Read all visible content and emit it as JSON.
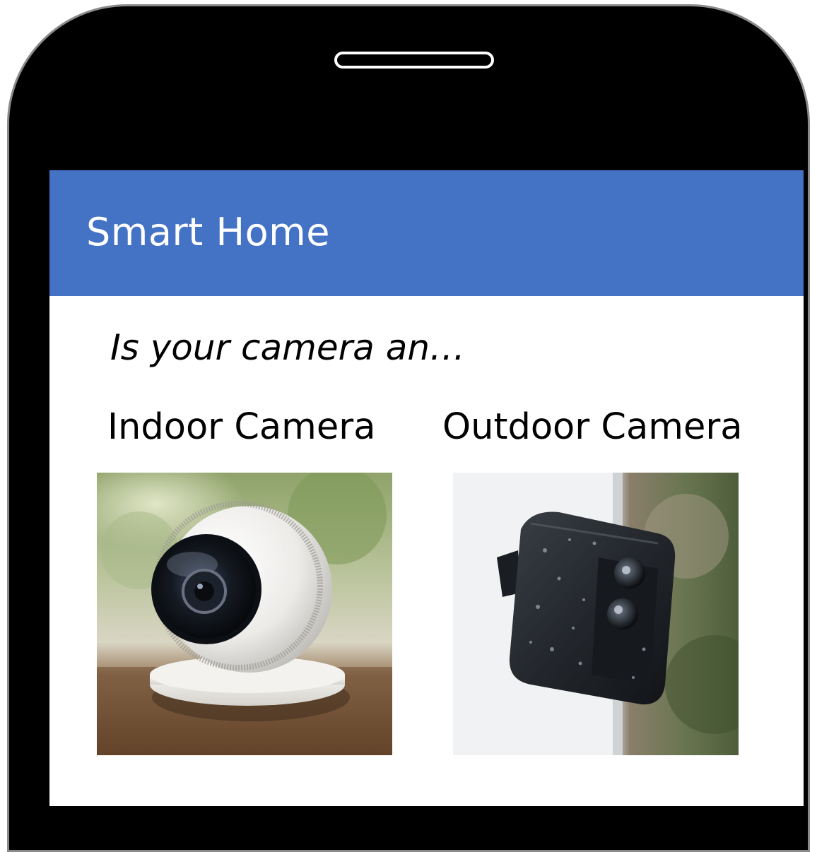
{
  "app": {
    "title": "Smart Home"
  },
  "prompt": {
    "question": "Is your camera an…"
  },
  "options": [
    {
      "label": "Indoor Camera",
      "image": "indoor-camera-photo"
    },
    {
      "label": "Outdoor Camera",
      "image": "outdoor-camera-photo"
    }
  ],
  "colors": {
    "app_bar": "#4472c4",
    "phone_body": "#000000",
    "screen": "#ffffff"
  }
}
